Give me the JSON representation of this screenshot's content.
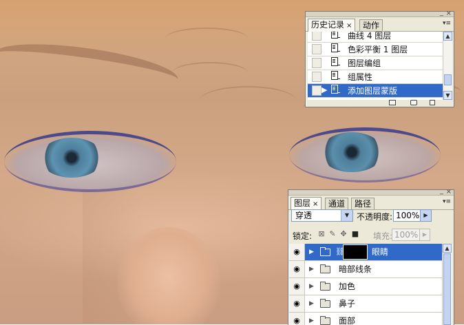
{
  "history": {
    "tabs": [
      {
        "label": "历史记录",
        "close": "×"
      },
      {
        "label": "动作"
      }
    ],
    "items": [
      {
        "label": "曲线 4 图层"
      },
      {
        "label": "色彩平衡 1 图层"
      },
      {
        "label": "图层编组"
      },
      {
        "label": "组属性"
      },
      {
        "label": "添加图层蒙版",
        "selected": true
      }
    ],
    "footer_icons": [
      "new-document-from-state-icon",
      "snapshot-camera-icon",
      "trash-icon"
    ]
  },
  "layers": {
    "tabs": [
      {
        "label": "图层",
        "close": "×"
      },
      {
        "label": "通道"
      },
      {
        "label": "路径"
      }
    ],
    "blend_mode": "穿透",
    "opacity_label": "不透明度:",
    "opacity_value": "100%",
    "lock_label": "锁定:",
    "fill_label": "填充:",
    "fill_value": "100%",
    "items": [
      {
        "name": "眼睛",
        "selected": true,
        "has_mask": true
      },
      {
        "name": "暗部线条"
      },
      {
        "name": "加色"
      },
      {
        "name": "鼻子"
      },
      {
        "name": "面部"
      }
    ]
  },
  "colors": {
    "selection": "#3069c8",
    "panel_bg": "#ece9d8"
  }
}
